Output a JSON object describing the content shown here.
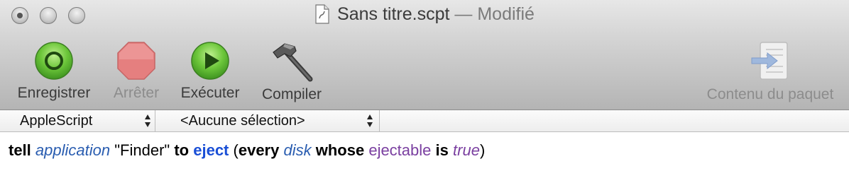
{
  "window": {
    "title": "Sans titre.scpt",
    "status": "— Modifié"
  },
  "toolbar": {
    "record_label": "Enregistrer",
    "stop_label": "Arrêter",
    "run_label": "Exécuter",
    "compile_label": "Compiler",
    "bundle_label": "Contenu du paquet"
  },
  "navigation": {
    "language": "AppleScript",
    "handler": "<Aucune sélection>"
  },
  "editor": {
    "tokens": {
      "t1": "tell",
      "t2": "application",
      "t3": "\"Finder\"",
      "t4": "to",
      "t5": "eject",
      "t6": "(",
      "t7": "every",
      "t8": "disk",
      "t9": "whose",
      "t10": "ejectable",
      "t11": "is",
      "t12": "true",
      "t13": ")"
    }
  },
  "colors": {
    "record_green": "#5cb833",
    "stop_red": "#e57373",
    "application_blue": "#2a5db0",
    "command_blue": "#1a4fd6",
    "property_purple": "#7a3fa0"
  },
  "icons": {
    "record": "record-circle-icon",
    "stop": "stop-octagon-icon",
    "run": "play-icon",
    "compile": "hammer-icon",
    "bundle": "bundle-contents-icon",
    "document": "script-document-icon"
  }
}
